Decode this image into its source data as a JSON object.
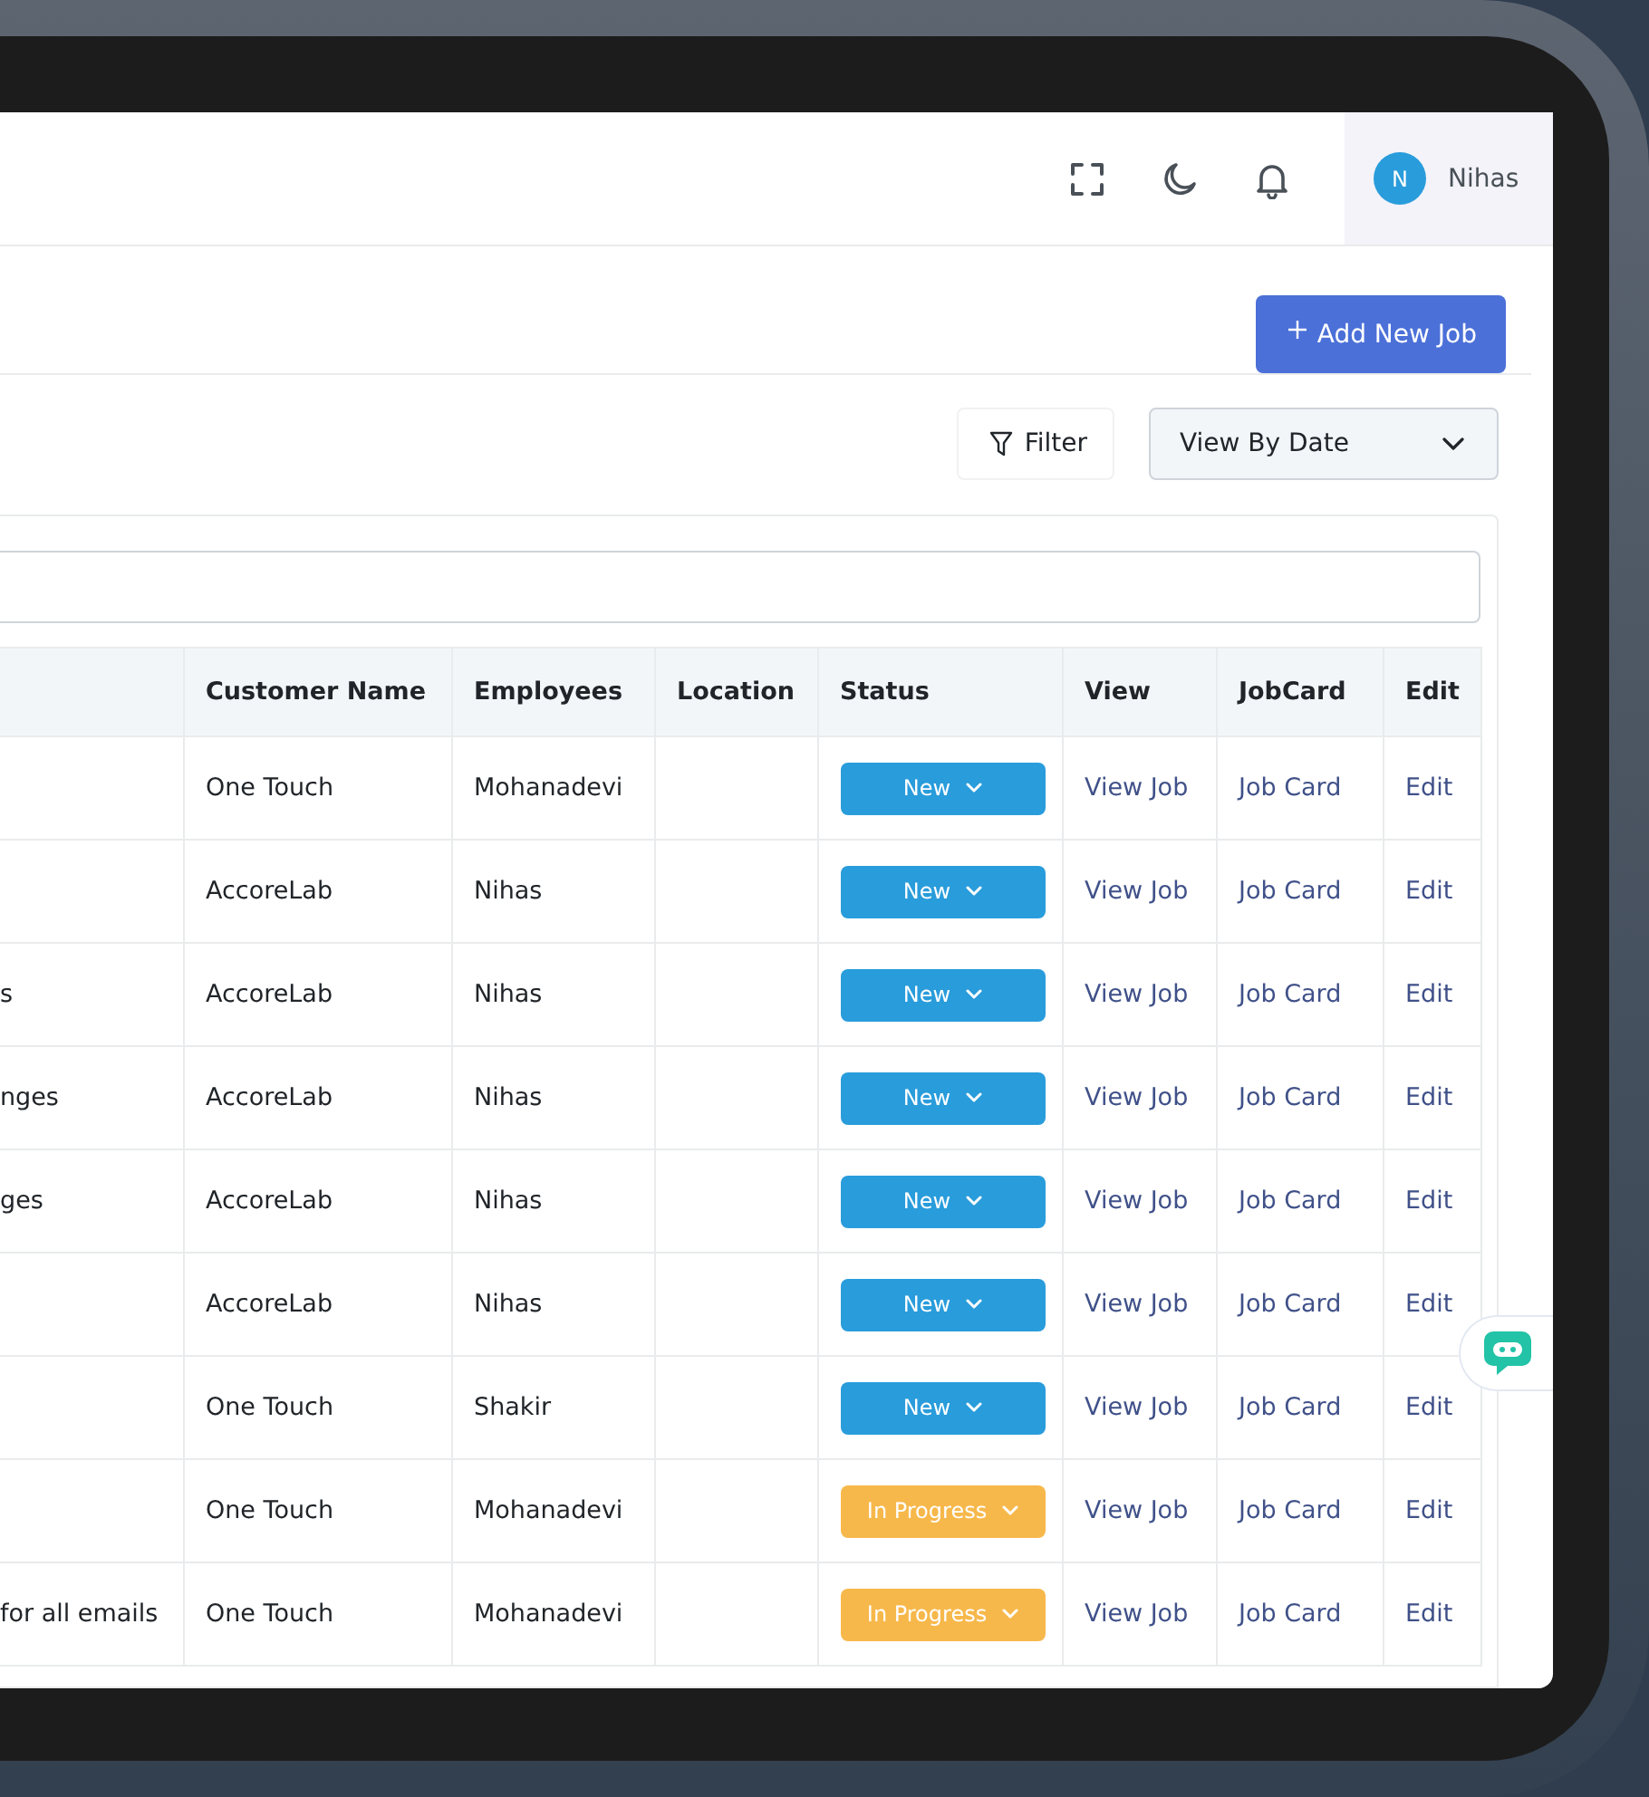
{
  "topbar": {
    "user": {
      "initial": "N",
      "name": "Nihas"
    }
  },
  "actions": {
    "add_button": "Add New Job",
    "filter_button": "Filter",
    "view_select": "View By Date"
  },
  "table": {
    "columns": [
      "Customer Name",
      "Employees",
      "Location",
      "Status",
      "View",
      "JobCard",
      "Edit"
    ],
    "rows": [
      {
        "column_1": "",
        "customer": "One Touch",
        "employee": "Mohanadevi",
        "location": "",
        "status": {
          "label": "New",
          "kind": "new"
        },
        "view": "View Job",
        "jobcard": "Job Card",
        "edit": "Edit"
      },
      {
        "column_1": "",
        "customer": "AccoreLab",
        "employee": "Nihas",
        "location": "",
        "status": {
          "label": "New",
          "kind": "new"
        },
        "view": "View Job",
        "jobcard": "Job Card",
        "edit": "Edit"
      },
      {
        "column_1": "s",
        "customer": "AccoreLab",
        "employee": "Nihas",
        "location": "",
        "status": {
          "label": "New",
          "kind": "new"
        },
        "view": "View Job",
        "jobcard": "Job Card",
        "edit": "Edit"
      },
      {
        "column_1": "nges",
        "customer": "AccoreLab",
        "employee": "Nihas",
        "location": "",
        "status": {
          "label": "New",
          "kind": "new"
        },
        "view": "View Job",
        "jobcard": "Job Card",
        "edit": "Edit"
      },
      {
        "column_1": "ges",
        "customer": "AccoreLab",
        "employee": "Nihas",
        "location": "",
        "status": {
          "label": "New",
          "kind": "new"
        },
        "view": "View Job",
        "jobcard": "Job Card",
        "edit": "Edit"
      },
      {
        "column_1": "",
        "customer": "AccoreLab",
        "employee": "Nihas",
        "location": "",
        "status": {
          "label": "New",
          "kind": "new"
        },
        "view": "View Job",
        "jobcard": "Job Card",
        "edit": "Edit"
      },
      {
        "column_1": "",
        "customer": "One Touch",
        "employee": "Shakir",
        "location": "",
        "status": {
          "label": "New",
          "kind": "new"
        },
        "view": "View Job",
        "jobcard": "Job Card",
        "edit": "Edit"
      },
      {
        "column_1": "",
        "customer": "One Touch",
        "employee": "Mohanadevi",
        "location": "",
        "status": {
          "label": "In Progress",
          "kind": "in_progress"
        },
        "view": "View Job",
        "jobcard": "Job Card",
        "edit": "Edit"
      },
      {
        "column_1": "for all emails",
        "customer": "One Touch",
        "employee": "Mohanadevi",
        "location": "",
        "status": {
          "label": "In Progress",
          "kind": "in_progress"
        },
        "view": "View Job",
        "jobcard": "Job Card",
        "edit": "Edit"
      }
    ]
  }
}
